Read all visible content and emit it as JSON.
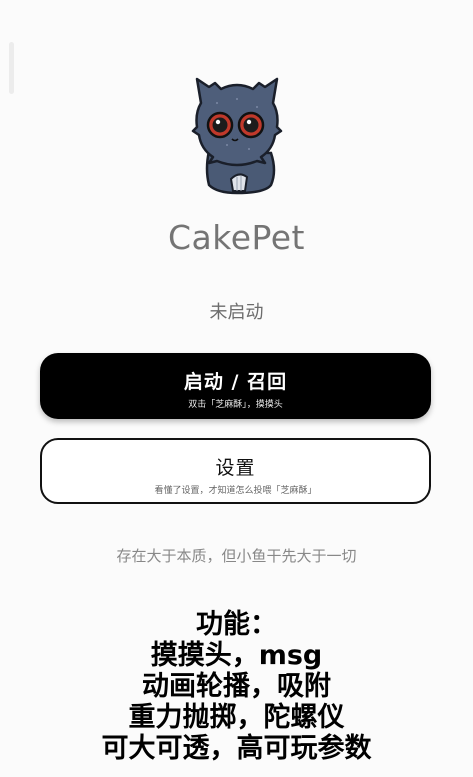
{
  "app": {
    "name": "CakePet",
    "status": "未启动"
  },
  "actions": {
    "launch": {
      "title": "启动 / 召回",
      "subtitle": "双击「芝麻酥」，摸摸头"
    },
    "settings": {
      "title": "设置",
      "subtitle": "看懂了设置，才知道怎么投喂「芝麻酥」"
    }
  },
  "tagline": "存在大于本质，但小鱼干先大于一切",
  "features": {
    "heading": "功能：",
    "lines": [
      "摸摸头，msg",
      "动画轮播，吸附",
      "重力抛掷，陀螺仪",
      "可大可透，高可玩参数"
    ]
  },
  "colors": {
    "primary_button": "#000000",
    "mascot_body": "#4a5a75",
    "mascot_eye": "#c0392b"
  },
  "icons": {
    "mascot": "cat-mascot-icon"
  }
}
